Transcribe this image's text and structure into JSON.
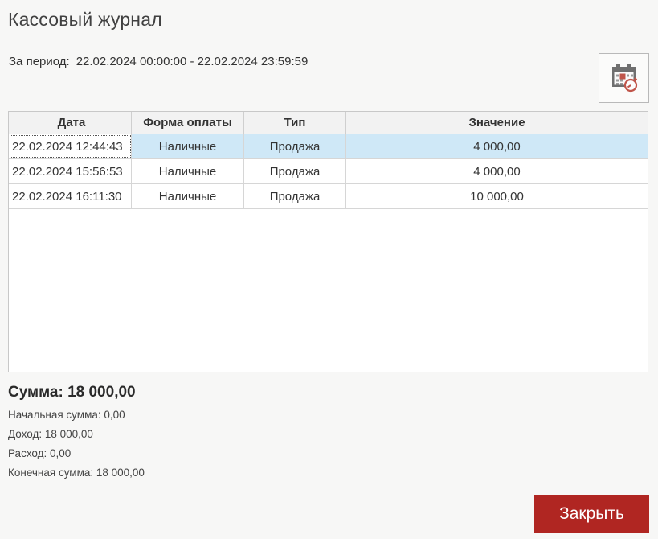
{
  "header": {
    "title": "Кассовый журнал",
    "period_label": "За период:",
    "period_range": "22.02.2024 00:00:00 -  22.02.2024 23:59:59"
  },
  "toolbar": {
    "datetime_button_icon": "calendar-clock-icon"
  },
  "table": {
    "columns": [
      "Дата",
      "Форма оплаты",
      "Тип",
      "Значение"
    ],
    "rows": [
      {
        "date": "22.02.2024 12:44:43",
        "payment_form": "Наличные",
        "type": "Продажа",
        "value": "4 000,00",
        "selected": true
      },
      {
        "date": "22.02.2024 15:56:53",
        "payment_form": "Наличные",
        "type": "Продажа",
        "value": "4 000,00",
        "selected": false
      },
      {
        "date": "22.02.2024 16:11:30",
        "payment_form": "Наличные",
        "type": "Продажа",
        "value": "10 000,00",
        "selected": false
      }
    ]
  },
  "summary": {
    "total_label": "Сумма:",
    "total_value": "18 000,00",
    "lines": [
      {
        "text": "Начальная сумма: 0,00"
      },
      {
        "text": "Доход: 18 000,00"
      },
      {
        "text": "Расход: 0,00"
      },
      {
        "text": "Конечная сумма: 18 000,00"
      }
    ]
  },
  "footer": {
    "close_label": "Закрыть"
  },
  "colors": {
    "accent_red": "#b02622",
    "selected_row": "#cfe8f7",
    "header_bg": "#f2f2f2",
    "grid_border": "#c8c8c8",
    "icon_gray": "#6f6f6f"
  }
}
